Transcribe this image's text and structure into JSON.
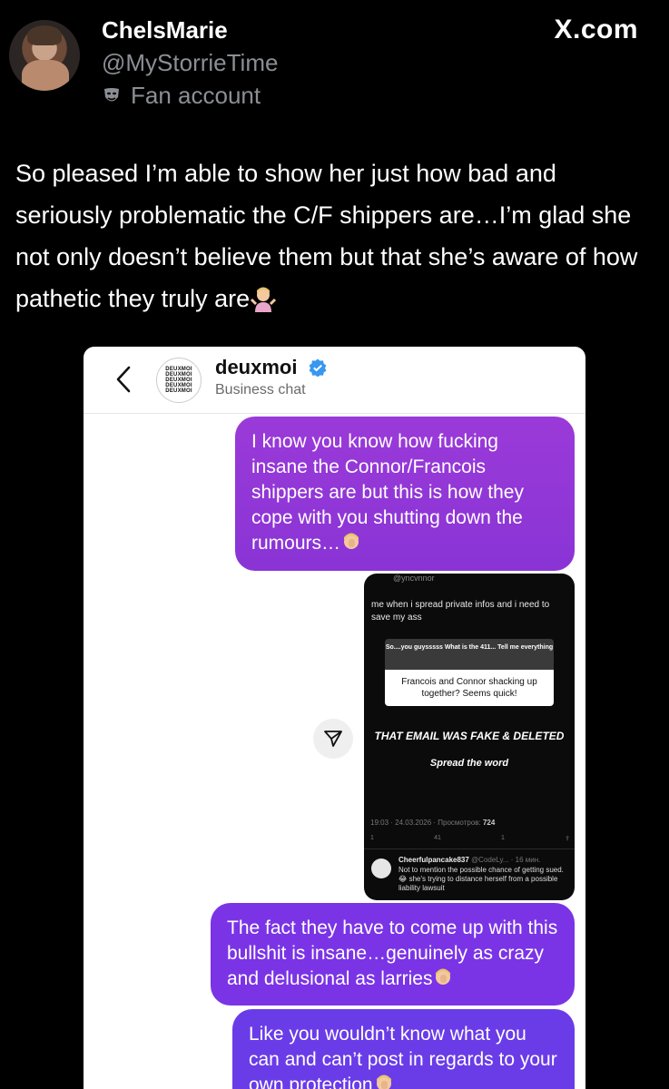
{
  "tweet": {
    "display_name": "ChelsMarie",
    "handle": "@MyStorrieTime",
    "label": "Fan account",
    "label_icon": "theater-mask-icon",
    "brand": "X.com",
    "text": "So pleased I’m able to show her just how bad and seriously problematic the C/F shippers are…I’m glad she not only doesn’t believe them but that she’s aware of how pathetic they truly are",
    "text_emoji": "person-shrugging-emoji"
  },
  "chat": {
    "name": "deuxmoi",
    "subtitle": "Business chat",
    "avatar_text": [
      "DEUXMOI",
      "DEUXMOI",
      "DEUXMOI",
      "DEUXMOI",
      "DEUXMOI"
    ],
    "accent_purple": "#8a34d6",
    "verified_color": "#3897f0",
    "messages": [
      {
        "text": "I know you know how fucking insane the Connor/Francois shippers are but this is how they cope with you shutting down the rumours…",
        "emoji": "person-facepalming-emoji"
      },
      {
        "text": "The fact they have to come up with this bullshit is insane…genuinely as crazy and delusional as larries",
        "emoji": "person-facepalming-emoji"
      },
      {
        "text": "Like you wouldn’t know what you can and can’t post in regards to your own protection",
        "emoji": "person-facepalming-emoji"
      }
    ],
    "shared_post": {
      "handle": "@yncvnnor",
      "caption": "me when i spread private infos and i need to save my ass",
      "question": "So....you guysssss What is the 411... Tell me everything",
      "answer": "Francois and Connor shacking up together? Seems quick!",
      "headline": "THAT EMAIL WAS FAKE & DELETED",
      "subline": "Spread the word",
      "meta": "19:03 · 24.03.2026 · Просмотров:",
      "views": "724",
      "actions": [
        "1",
        "41",
        "1"
      ],
      "reply_name": "Cheerfulpancake837",
      "reply_meta": "@CodeLy... · 16 мин.",
      "reply_text": "Not to mention the possible chance of getting sued. 😂 she's trying to distance herself from a possible liability lawsuit"
    }
  }
}
